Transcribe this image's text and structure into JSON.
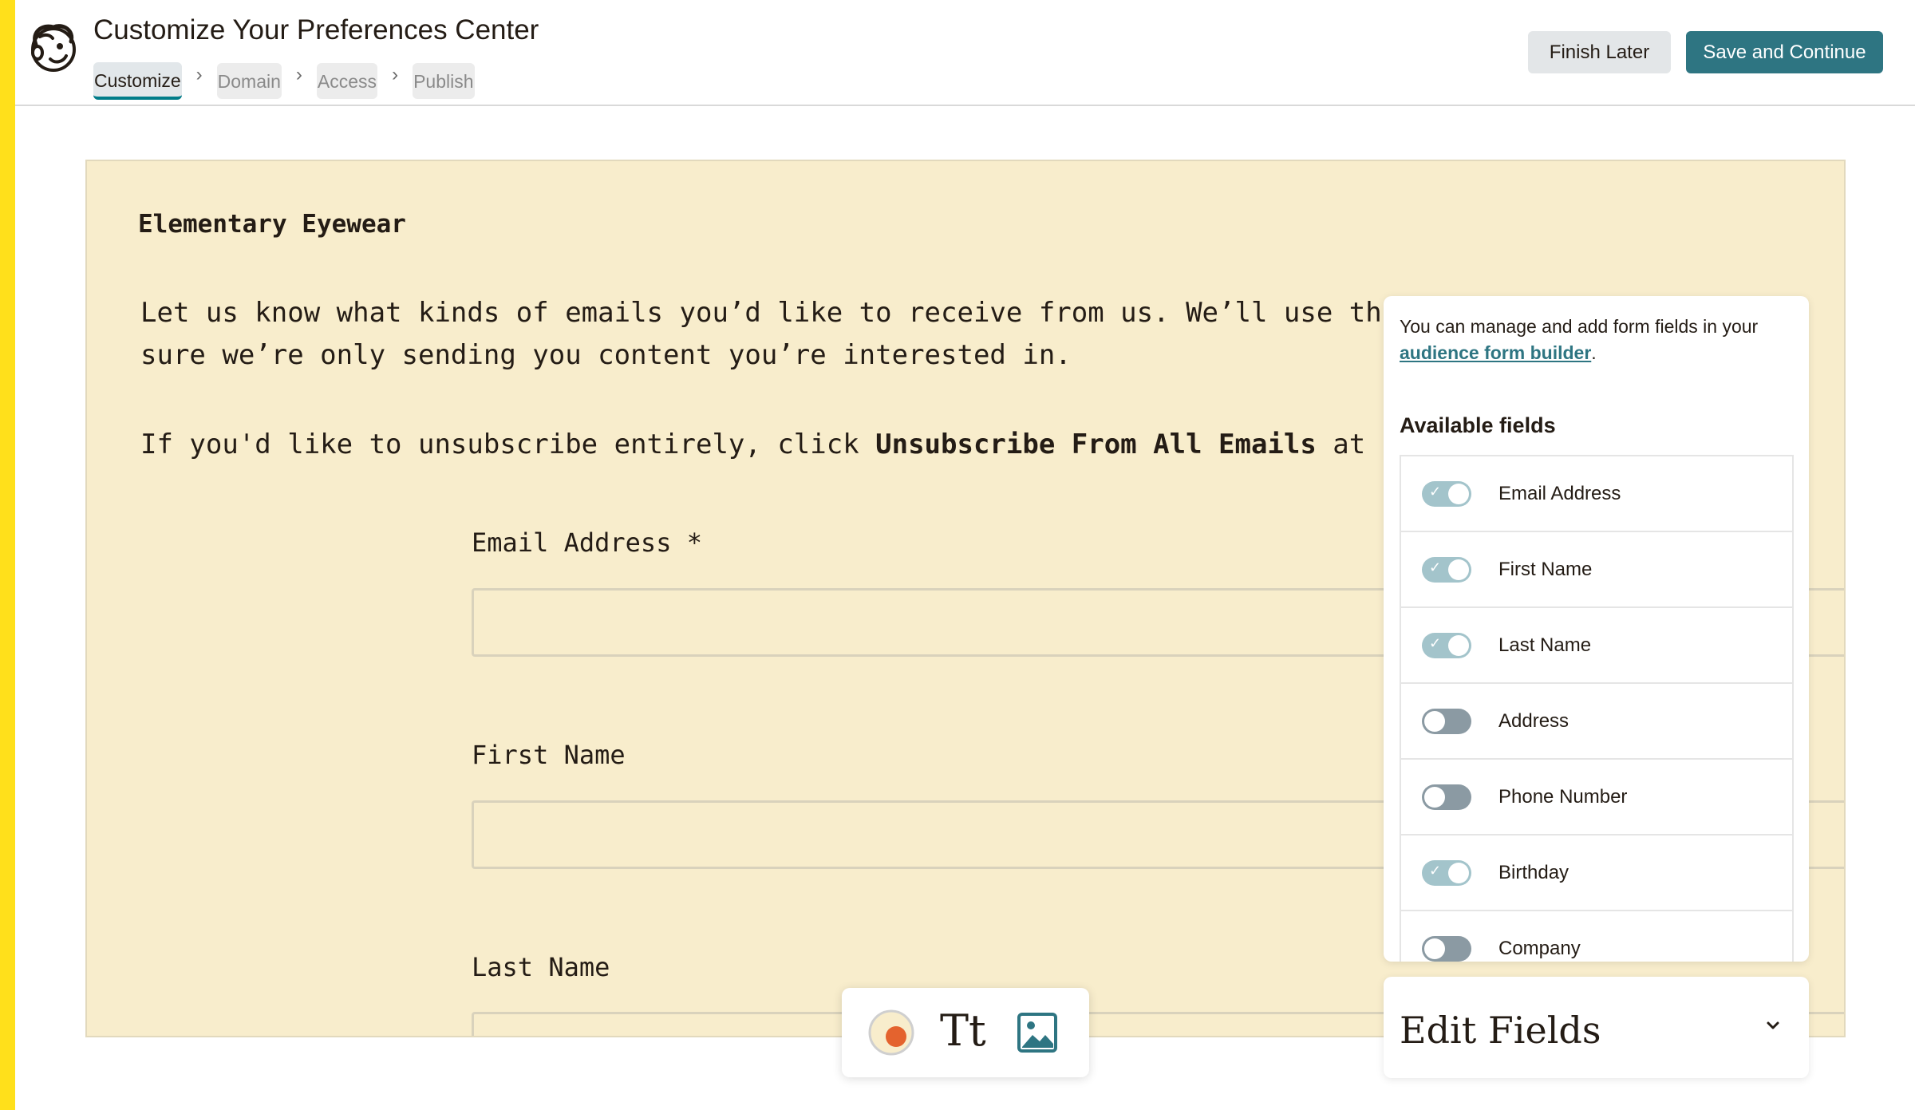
{
  "header": {
    "title": "Customize Your Preferences Center",
    "steps": [
      "Customize",
      "Domain",
      "Access",
      "Publish"
    ],
    "active_step": "Customize",
    "finish_later_label": "Finish Later",
    "save_continue_label": "Save and Continue"
  },
  "canvas": {
    "brand": "Elementary Eyewear",
    "intro_line1": "Let us know what kinds of emails you’d like to receive from us. We’ll use th",
    "intro_line2": "sure we’re only sending you content you’re interested in.",
    "unsub_prefix": "If you'd like to unsubscribe entirely, click ",
    "unsub_bold": "Unsubscribe From All Emails",
    "unsub_suffix": " at",
    "form_fields": [
      {
        "label": "Email Address *"
      },
      {
        "label": "First Name"
      },
      {
        "label": "Last Name"
      }
    ]
  },
  "panel": {
    "note_text": "You can manage and add form fields in your ",
    "note_link": "audience form builder",
    "note_end": ".",
    "available_title": "Available fields",
    "fields": [
      {
        "name": "Email Address",
        "enabled": true
      },
      {
        "name": "First Name",
        "enabled": true
      },
      {
        "name": "Last Name",
        "enabled": true
      },
      {
        "name": "Address",
        "enabled": false
      },
      {
        "name": "Phone Number",
        "enabled": false
      },
      {
        "name": "Birthday",
        "enabled": true
      },
      {
        "name": "Company",
        "enabled": false
      }
    ]
  },
  "edit_fields": {
    "title": "Edit Fields"
  },
  "toolbar": {
    "text_tool_glyph": "Tt"
  },
  "colors": {
    "accent": "#2e7582",
    "brand_yellow": "#ffe01b",
    "canvas_bg": "#f8edcc",
    "color_dot": "#e4632e"
  },
  "icons": {
    "logo": "mailchimp-freddie-icon",
    "step_separator": "chevron-right-icon",
    "toggle_check": "check-icon",
    "edit_fields_toggle": "chevron-down-icon",
    "color_tool": "color-picker-icon",
    "text_tool": "text-style-icon",
    "image_tool": "image-icon"
  }
}
